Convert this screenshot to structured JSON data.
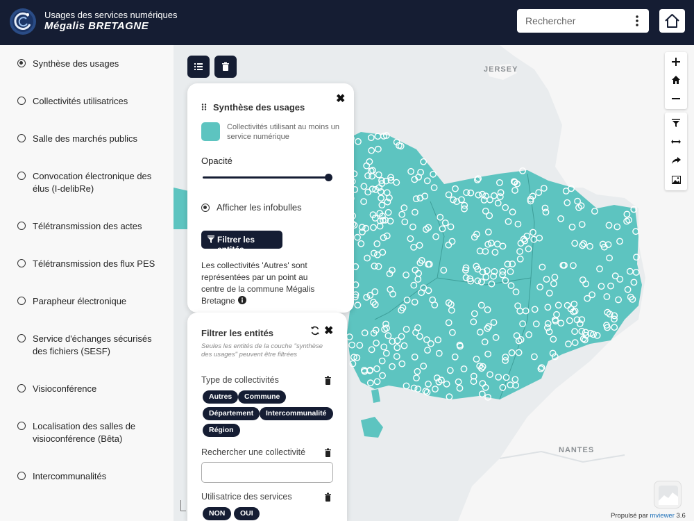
{
  "header": {
    "title_line1": "Usages des services numériques",
    "title_line2": "Mégalis BRETAGNE",
    "search_placeholder": "Rechercher"
  },
  "sidebar": {
    "items": [
      {
        "label": "Synthèse des usages",
        "selected": true
      },
      {
        "label": "Collectivités utilisatrices",
        "selected": false
      },
      {
        "label": "Salle des marchés publics",
        "selected": false
      },
      {
        "label": "Convocation électronique des élus (I-delibRe)",
        "selected": false
      },
      {
        "label": "Télétransmission des actes",
        "selected": false
      },
      {
        "label": "Télétransmission des flux PES",
        "selected": false
      },
      {
        "label": "Parapheur électronique",
        "selected": false
      },
      {
        "label": "Service d'échanges sécurisés des fichiers (SESF)",
        "selected": false
      },
      {
        "label": "Visioconférence",
        "selected": false
      },
      {
        "label": "Localisation des salles de visioconférence (Bêta)",
        "selected": false
      },
      {
        "label": "Intercommunalités",
        "selected": false
      }
    ]
  },
  "map": {
    "labels": {
      "jersey": "JERSEY",
      "nantes": "NANTES"
    },
    "fill_color": "#5dc4c0"
  },
  "legend_panel": {
    "title": "Synthèse des usages",
    "legend_label": "Collectivités utilisant au moins un service numérique",
    "opacity_label": "Opacité",
    "opacity_value": 1.0,
    "tooltip_label": "Afficher les infobulles",
    "filter_button": "Filtrer les entités",
    "note": "Les collectivités 'Autres' sont représentées par un point au centre de la commune Mégalis Bretagne"
  },
  "filter_panel": {
    "title": "Filtrer les entités",
    "subtitle": "Seules les entités de la couche \"synthèse des usages\" peuvent être filtrées",
    "type_label": "Type de collectivités",
    "type_chips": [
      "Autres",
      "Commune",
      "Département",
      "Intercommunalité",
      "Région"
    ],
    "search_label": "Rechercher une collectivité",
    "search_value": "",
    "user_label": "Utilisatrice des services",
    "user_chips": [
      "NON",
      "OUI"
    ]
  },
  "attribution": {
    "prefix": "Propulsé par",
    "link": "mviewer",
    "version": "3.6"
  }
}
